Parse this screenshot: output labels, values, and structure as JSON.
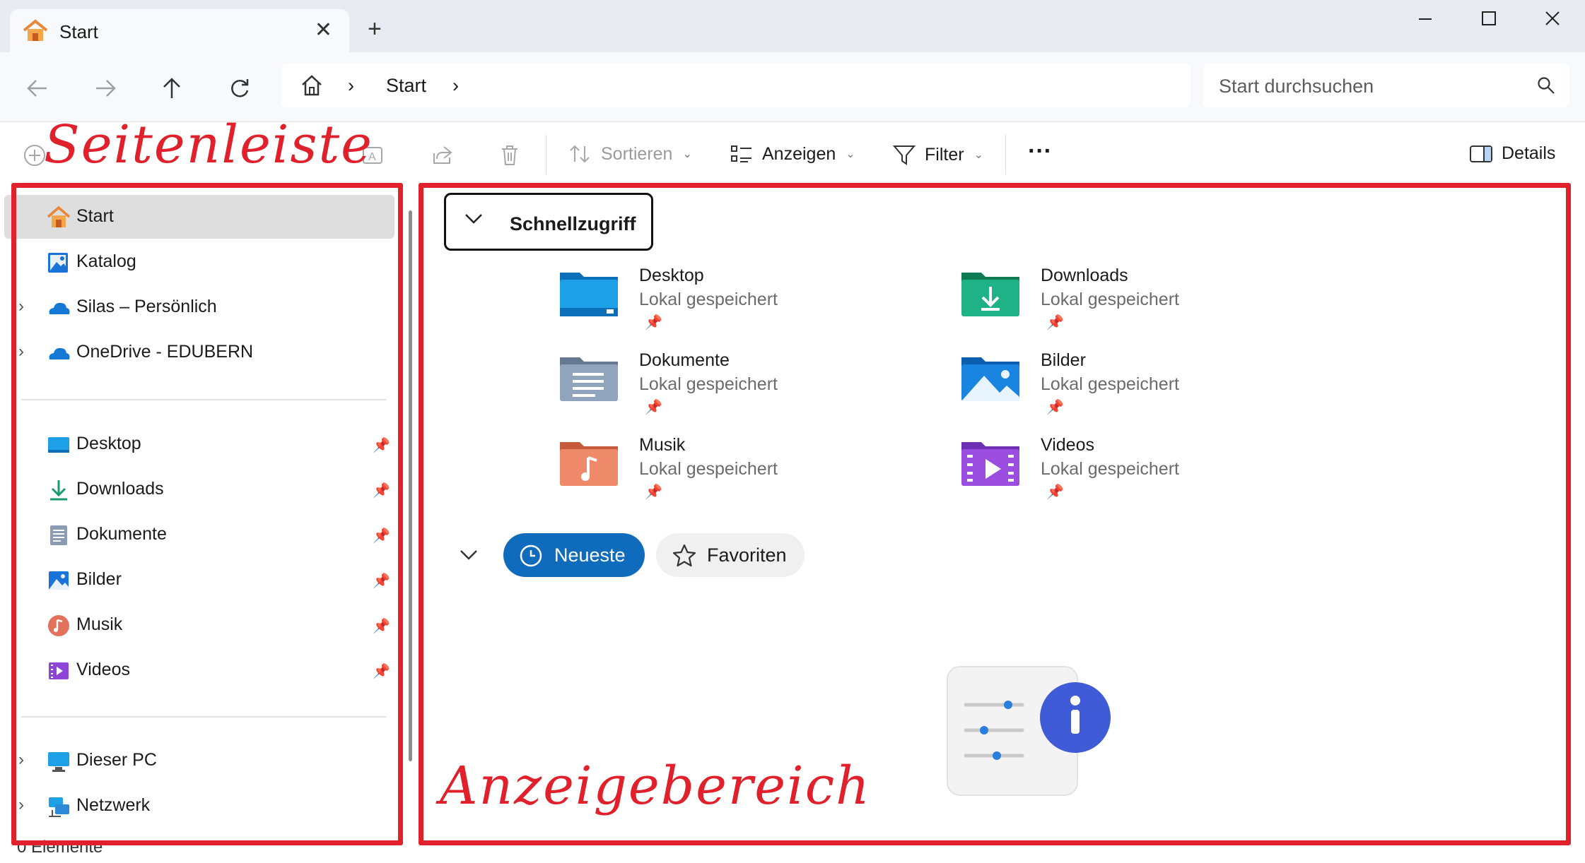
{
  "window": {
    "tab_title": "Start",
    "tab_close": "✕",
    "new_tab": "+",
    "minimize": "—",
    "maximize": "☐",
    "close": "✕"
  },
  "address_bar": {
    "crumb_separator": "›",
    "crumbs": [
      "Start"
    ],
    "search_placeholder": "Start durchsuchen"
  },
  "command_bar": {
    "sort_label": "Sortieren",
    "view_label": "Anzeigen",
    "filter_label": "Filter",
    "more_label": "···",
    "details_label": "Details"
  },
  "sidebar": {
    "top_items": [
      {
        "label": "Start",
        "icon": "home-icon",
        "selected": true
      },
      {
        "label": "Katalog",
        "icon": "gallery-icon"
      },
      {
        "label": "Silas – Persönlich",
        "icon": "onedrive-icon",
        "expandable": true
      },
      {
        "label": "OneDrive - EDUBERN",
        "icon": "onedrive-icon",
        "expandable": true
      }
    ],
    "pinned_items": [
      {
        "label": "Desktop",
        "icon": "desktop-folder-icon"
      },
      {
        "label": "Downloads",
        "icon": "downloads-icon"
      },
      {
        "label": "Dokumente",
        "icon": "documents-icon"
      },
      {
        "label": "Bilder",
        "icon": "pictures-icon"
      },
      {
        "label": "Musik",
        "icon": "music-icon"
      },
      {
        "label": "Videos",
        "icon": "videos-icon"
      }
    ],
    "bottom_items": [
      {
        "label": "Dieser PC",
        "icon": "this-pc-icon",
        "expandable": true
      },
      {
        "label": "Netzwerk",
        "icon": "network-icon",
        "expandable": true
      }
    ],
    "expand_glyph": "›",
    "pin_glyph": "📌"
  },
  "status_bar": {
    "text": "0 Elemente"
  },
  "quick_access": {
    "header": "Schnellzugriff",
    "tiles": [
      {
        "name": "Desktop",
        "subtitle": "Lokal gespeichert",
        "icon": "desktop-folder-icon"
      },
      {
        "name": "Downloads",
        "subtitle": "Lokal gespeichert",
        "icon": "downloads-folder-icon"
      },
      {
        "name": "Dokumente",
        "subtitle": "Lokal gespeichert",
        "icon": "documents-folder-icon"
      },
      {
        "name": "Bilder",
        "subtitle": "Lokal gespeichert",
        "icon": "pictures-folder-icon"
      },
      {
        "name": "Musik",
        "subtitle": "Lokal gespeichert",
        "icon": "music-folder-icon"
      },
      {
        "name": "Videos",
        "subtitle": "Lokal gespeichert",
        "icon": "videos-folder-icon"
      }
    ]
  },
  "recent": {
    "neueste_label": "Neueste",
    "favoriten_label": "Favoriten"
  },
  "annotations": {
    "sidebar_label": "Seitenleiste",
    "content_label": "Anzeigebereich",
    "color": "#e0202a"
  },
  "colors": {
    "accent": "#0f6cbd",
    "selected_row": "#dedede"
  }
}
